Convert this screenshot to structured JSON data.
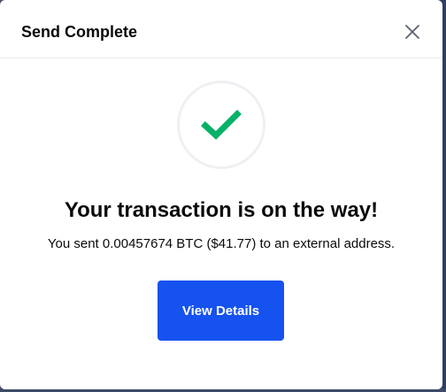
{
  "modal": {
    "title": "Send Complete",
    "close_icon": "close-icon",
    "success_icon": "checkmark-icon",
    "headline": "Your transaction is on the way!",
    "message": "You sent 0.00457674 BTC ($41.77) to an external address.",
    "button_label": "View Details"
  },
  "colors": {
    "accent": "#1652f0",
    "success": "#05b169",
    "text": "#0a0b0d",
    "circle_border": "#eef0f3"
  }
}
